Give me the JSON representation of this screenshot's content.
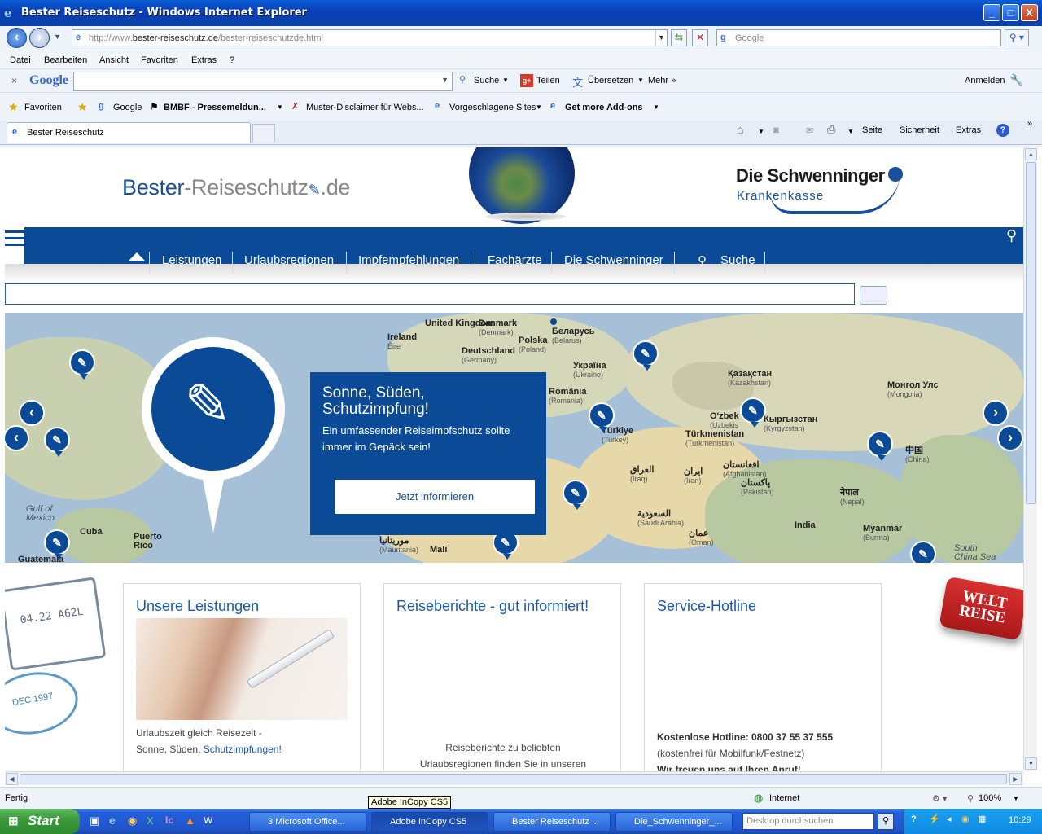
{
  "window": {
    "title": "Bester Reiseschutz - Windows Internet Explorer",
    "controls": {
      "minimize": "_",
      "maximize": "□",
      "close": "X"
    }
  },
  "address_bar": {
    "url_prefix": "http://www.",
    "url_domain": "bester-reiseschutz.de",
    "url_path": "/bester-reiseschutzde.html",
    "search_placeholder": "Google"
  },
  "menu": [
    "Datei",
    "Bearbeiten",
    "Ansicht",
    "Favoriten",
    "Extras",
    "?"
  ],
  "google_toolbar": {
    "logo": "Google",
    "search_label": "Suche",
    "share_label": "Teilen",
    "translate_label": "Übersetzen",
    "more_label": "Mehr »",
    "signin_label": "Anmelden"
  },
  "favorites_bar": {
    "favorites_label": "Favoriten",
    "items": [
      "Google",
      "BMBF - Pressemeldun...",
      "Muster-Disclaimer für Webs...",
      "Vorgeschlagene Sites",
      "Get more Add-ons"
    ]
  },
  "tabs": [
    {
      "label": "Bester Reiseschutz"
    }
  ],
  "command_bar": {
    "page": "Seite",
    "safety": "Sicherheit",
    "tools": "Extras"
  },
  "site": {
    "logo_main": "Bester",
    "logo_dash": "-Reiseschutz",
    "logo_tld": ".de",
    "partner_name": "Die Schwenninger",
    "partner_sub": "Krankenkasse",
    "nav": [
      "Leistungen",
      "Urlaubsregionen",
      "Impfempfehlungen",
      "Fachärzte",
      "Die Schwenninger",
      "Suche"
    ],
    "promo": {
      "headline": "Sonne, Süden, Schutzimpfung!",
      "text": "Ein umfassender Reiseimpfschutz sollte immer im Gepäck sein!",
      "button": "Jetzt informieren"
    },
    "map_labels": [
      {
        "name": "United Kingdom",
        "sub": ""
      },
      {
        "name": "Ireland",
        "sub": "Éire"
      },
      {
        "name": "Danmark",
        "sub": "(Denmark)"
      },
      {
        "name": "Deutschland",
        "sub": "(Germany)"
      },
      {
        "name": "Polska",
        "sub": "(Poland)"
      },
      {
        "name": "Беларусь",
        "sub": "(Belarus)"
      },
      {
        "name": "Україна",
        "sub": "(Ukraine)"
      },
      {
        "name": "România",
        "sub": "(Romania)"
      },
      {
        "name": "Türkiye",
        "sub": "(Turkey)"
      },
      {
        "name": "Қазақстан",
        "sub": "(Kazakhstan)"
      },
      {
        "name": "O'zbek",
        "sub": "(Uzbekis"
      },
      {
        "name": "Кыргызстан",
        "sub": "(Kyrgyzstan)"
      },
      {
        "name": "Монгол Улс",
        "sub": "(Mongolia)"
      },
      {
        "name": "Türkmenistan",
        "sub": "(Turkmenistan)"
      },
      {
        "name": "中国",
        "sub": "(China)"
      },
      {
        "name": "افغانستان",
        "sub": "(Afghanistan)"
      },
      {
        "name": "العراق",
        "sub": "(Iraq)"
      },
      {
        "name": "ایران",
        "sub": "(Iran)"
      },
      {
        "name": "پاکستان",
        "sub": "(Pakistan)"
      },
      {
        "name": "नेपाल",
        "sub": "(Nepal)"
      },
      {
        "name": "India",
        "sub": ""
      },
      {
        "name": "Myanmar",
        "sub": "(Burma)"
      },
      {
        "name": "السعودية",
        "sub": "(Saudi Arabia)"
      },
      {
        "name": "عمان",
        "sub": "(Oman)"
      },
      {
        "name": "موريتانيا",
        "sub": "(Mauritania)"
      },
      {
        "name": "Mali",
        "sub": ""
      },
      {
        "name": "Cuba",
        "sub": ""
      },
      {
        "name": "Puerto Rico",
        "sub": ""
      },
      {
        "name": "Guatemala",
        "sub": ""
      },
      {
        "name": "Gulf of Mexico",
        "sub": ""
      },
      {
        "name": "South China Sea",
        "sub": ""
      }
    ],
    "boxes": [
      {
        "title": "Unsere Leistungen",
        "text1": "Urlaubszeit gleich Reisezeit -",
        "text2": "Sonne, Süden, ",
        "link": "Schutzimpfungen",
        "text3": "!"
      },
      {
        "title": "Reiseberichte - gut informiert!",
        "text1": "Reiseberichte zu beliebten",
        "text2": "Urlaubsregionen finden Sie in unseren"
      },
      {
        "title": "Service-Hotline",
        "hotline_label": "Kostenlose Hotline: 0800 37 55 37 555",
        "note": "(kostenfrei für Mobilfunk/Festnetz)",
        "closing": "Wir freuen uns auf Ihren Anruf!"
      }
    ],
    "stamp_text": "04.22 A62L",
    "stamp2_text": "DEC 1997",
    "tag_text": "WELT REISE"
  },
  "status_bar": {
    "status": "Fertig",
    "zone": "Internet",
    "zoom": "100%"
  },
  "taskbar": {
    "start": "Start",
    "tasks": [
      "3 Microsoft Office...",
      "Adobe InCopy CS5",
      "Bester Reiseschutz ...",
      "Die_Schwenninger_..."
    ],
    "desktop_search_placeholder": "Desktop durchsuchen",
    "clock": "10:29"
  },
  "tooltip": "Adobe InCopy CS5"
}
